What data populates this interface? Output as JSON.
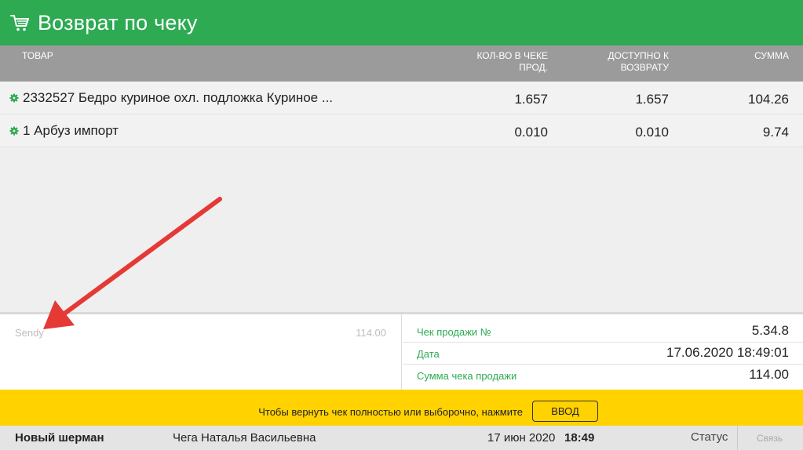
{
  "header": {
    "title": "Возврат по чеку",
    "icon": "cart-icon",
    "color": "#2eaa53"
  },
  "table": {
    "columns": {
      "item": "ТОВАР",
      "qty_line1": "КОЛ-ВО В ЧЕКЕ",
      "qty_line2": "ПРОД.",
      "avail_line1": "ДОСТУПНО К",
      "avail_line2": "ВОЗВРАТУ",
      "sum": "СУММА"
    },
    "rows": [
      {
        "name": "2332527 Бедро куриное охл. подложка Куриное ...",
        "qty": "1.657",
        "available": "1.657",
        "sum": "104.26"
      },
      {
        "name": "1 Арбуз импорт",
        "qty": "0.010",
        "available": "0.010",
        "sum": "9.74"
      }
    ]
  },
  "payment": {
    "name": "Sendy",
    "amount": "114.00"
  },
  "receipt": {
    "number_label": "Чек продажи №",
    "number": "5.34.8",
    "date_label": "Дата",
    "date": "17.06.2020 18:49:01",
    "total_label": "Сумма чека продажи",
    "total": "114.00"
  },
  "prompt": {
    "message": "Чтобы вернуть чек полностью или выборочно, нажмите",
    "button_label": "ВВОД",
    "color": "#ffd200"
  },
  "statusbar": {
    "store": "Новый шерман",
    "cashier": "Чега Наталья Васильевна",
    "date": "17 июн 2020",
    "time": "18:49",
    "status_label": "Статус",
    "link_label": "Связь"
  }
}
